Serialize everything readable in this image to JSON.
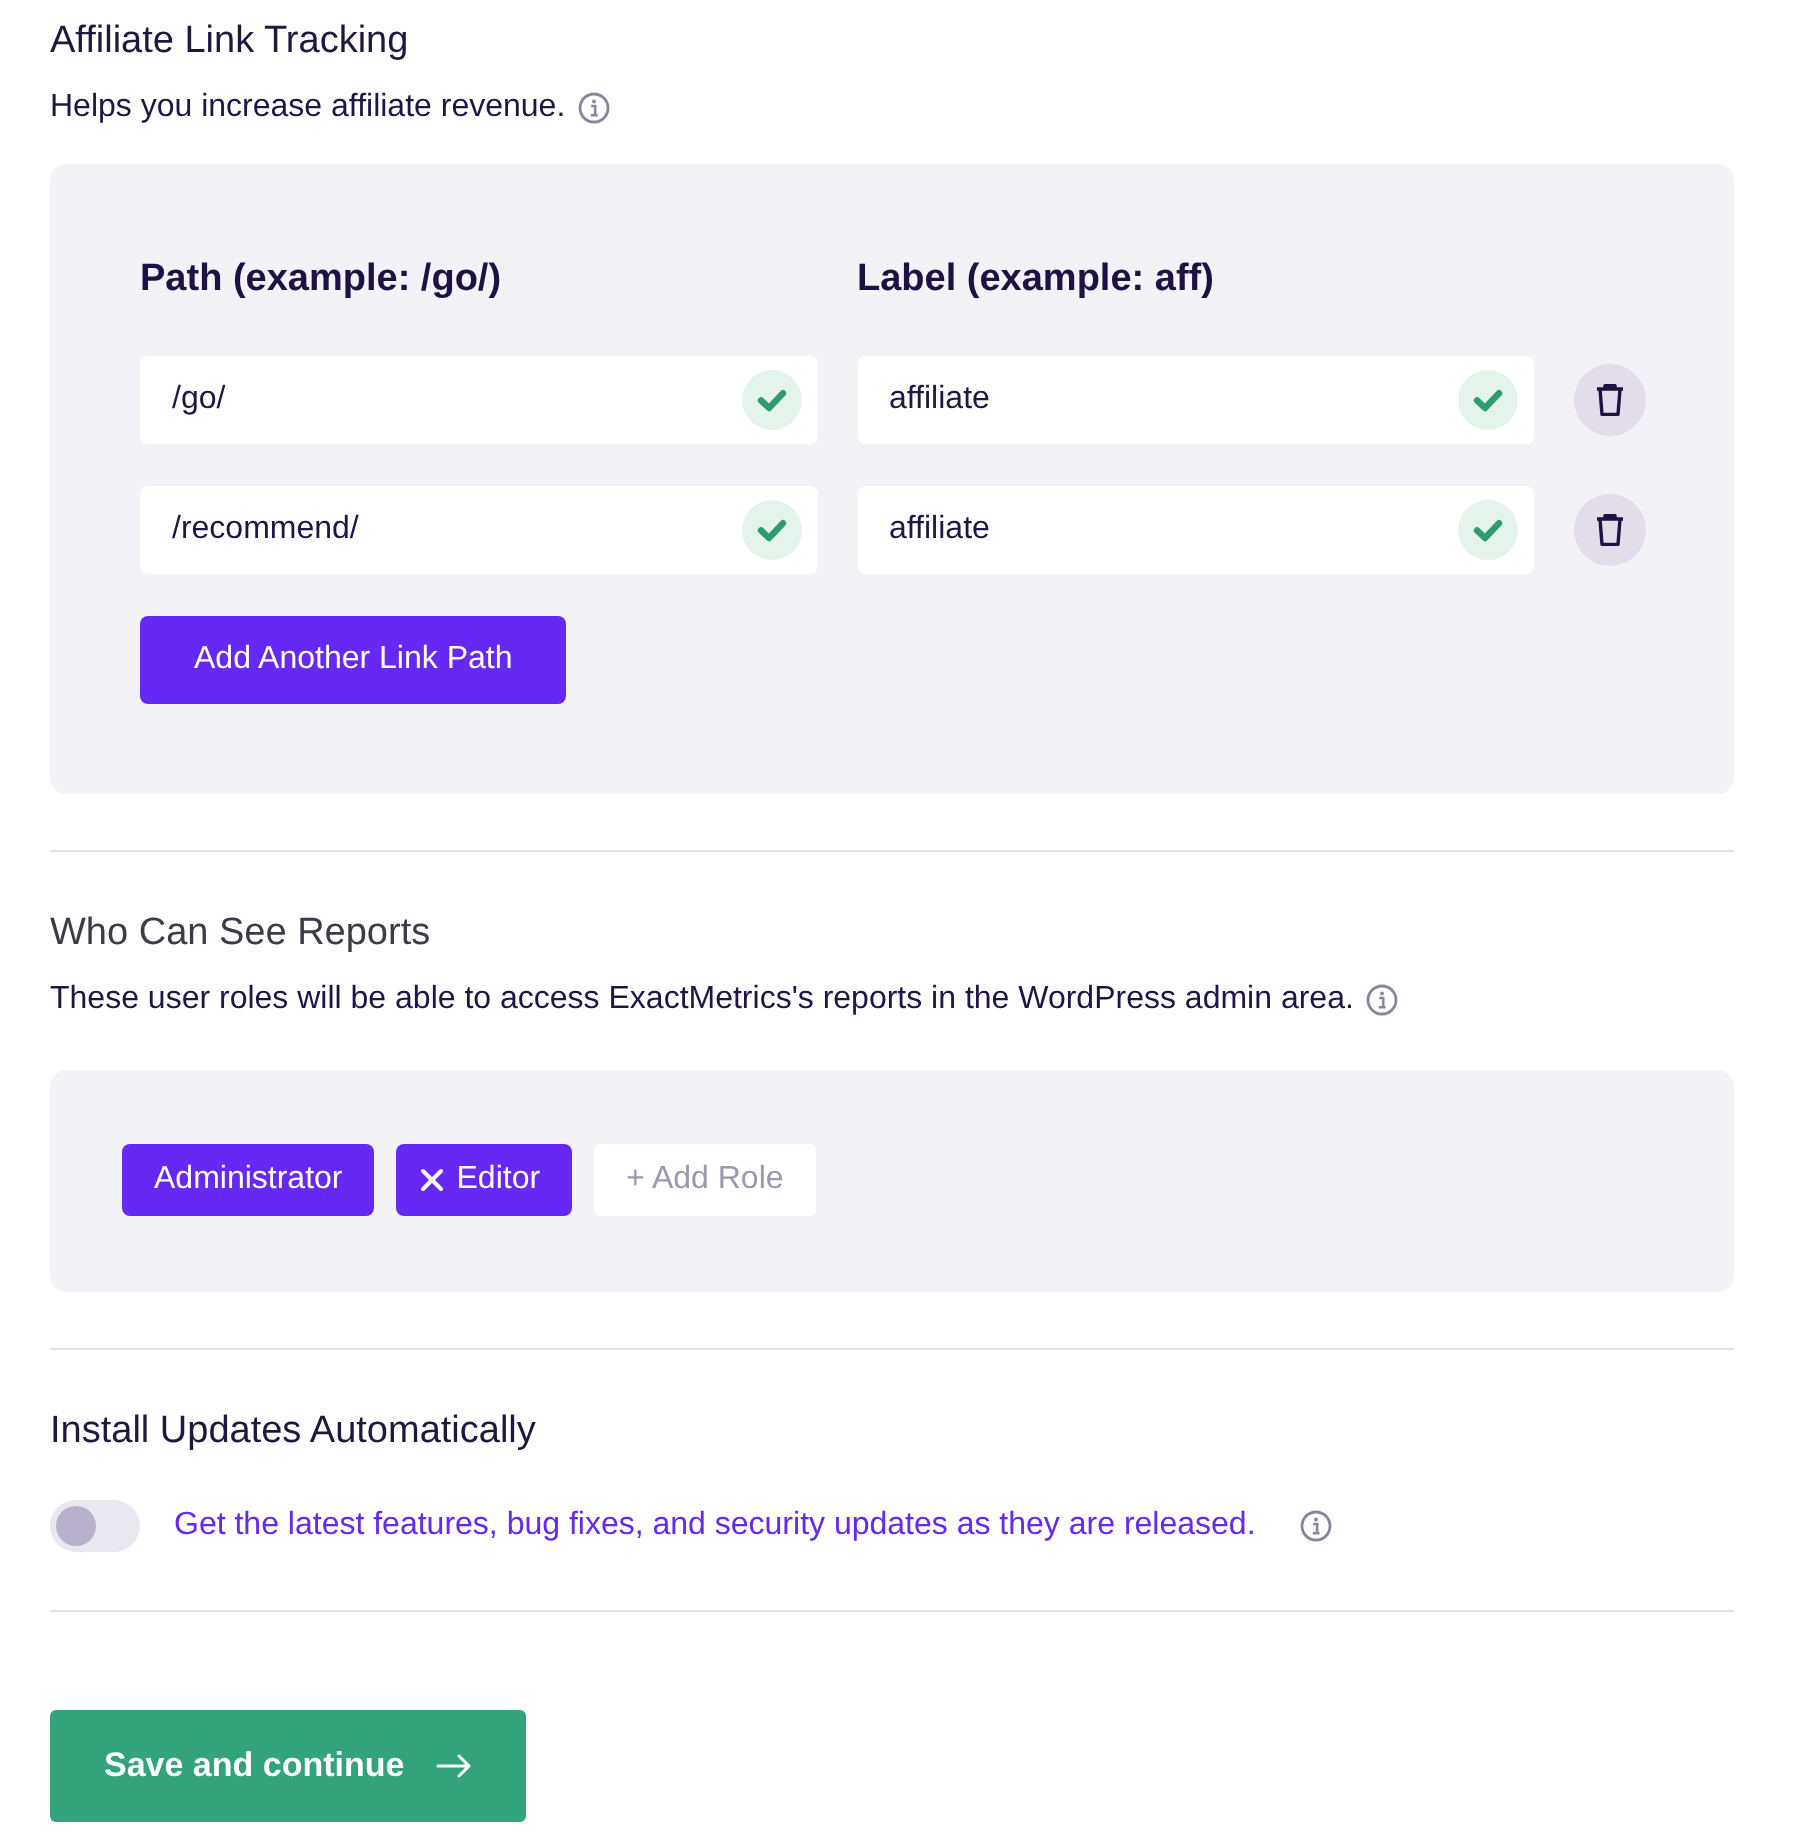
{
  "affiliate_tracking": {
    "title": "Affiliate Link Tracking",
    "description": "Helps you increase affiliate revenue.",
    "columns": [
      "Path (example: /go/)",
      "Label (example: aff)"
    ],
    "rows": [
      {
        "path": {
          "value": "/go/",
          "valid": true
        },
        "label": {
          "value": "affiliate",
          "valid": true
        }
      },
      {
        "path": {
          "value": "/recommend/",
          "valid": true
        },
        "label": {
          "value": "affiliate",
          "valid": true
        }
      }
    ],
    "add_button": "Add Another Link Path"
  },
  "report_access": {
    "title": "Who Can See Reports",
    "description": "These user roles will be able to access ExactMetrics's reports in the WordPress admin area.",
    "roles": [
      {
        "label": "Administrator",
        "removable": false
      },
      {
        "label": "Editor",
        "removable": true
      }
    ],
    "add_role": {
      "placeholder": "+ Add Role"
    }
  },
  "auto_updates": {
    "title": "Install Updates Automatically",
    "on": false,
    "description": "Get the latest features, bug fixes, and security updates as they are released."
  },
  "save_button": "Save and continue"
}
